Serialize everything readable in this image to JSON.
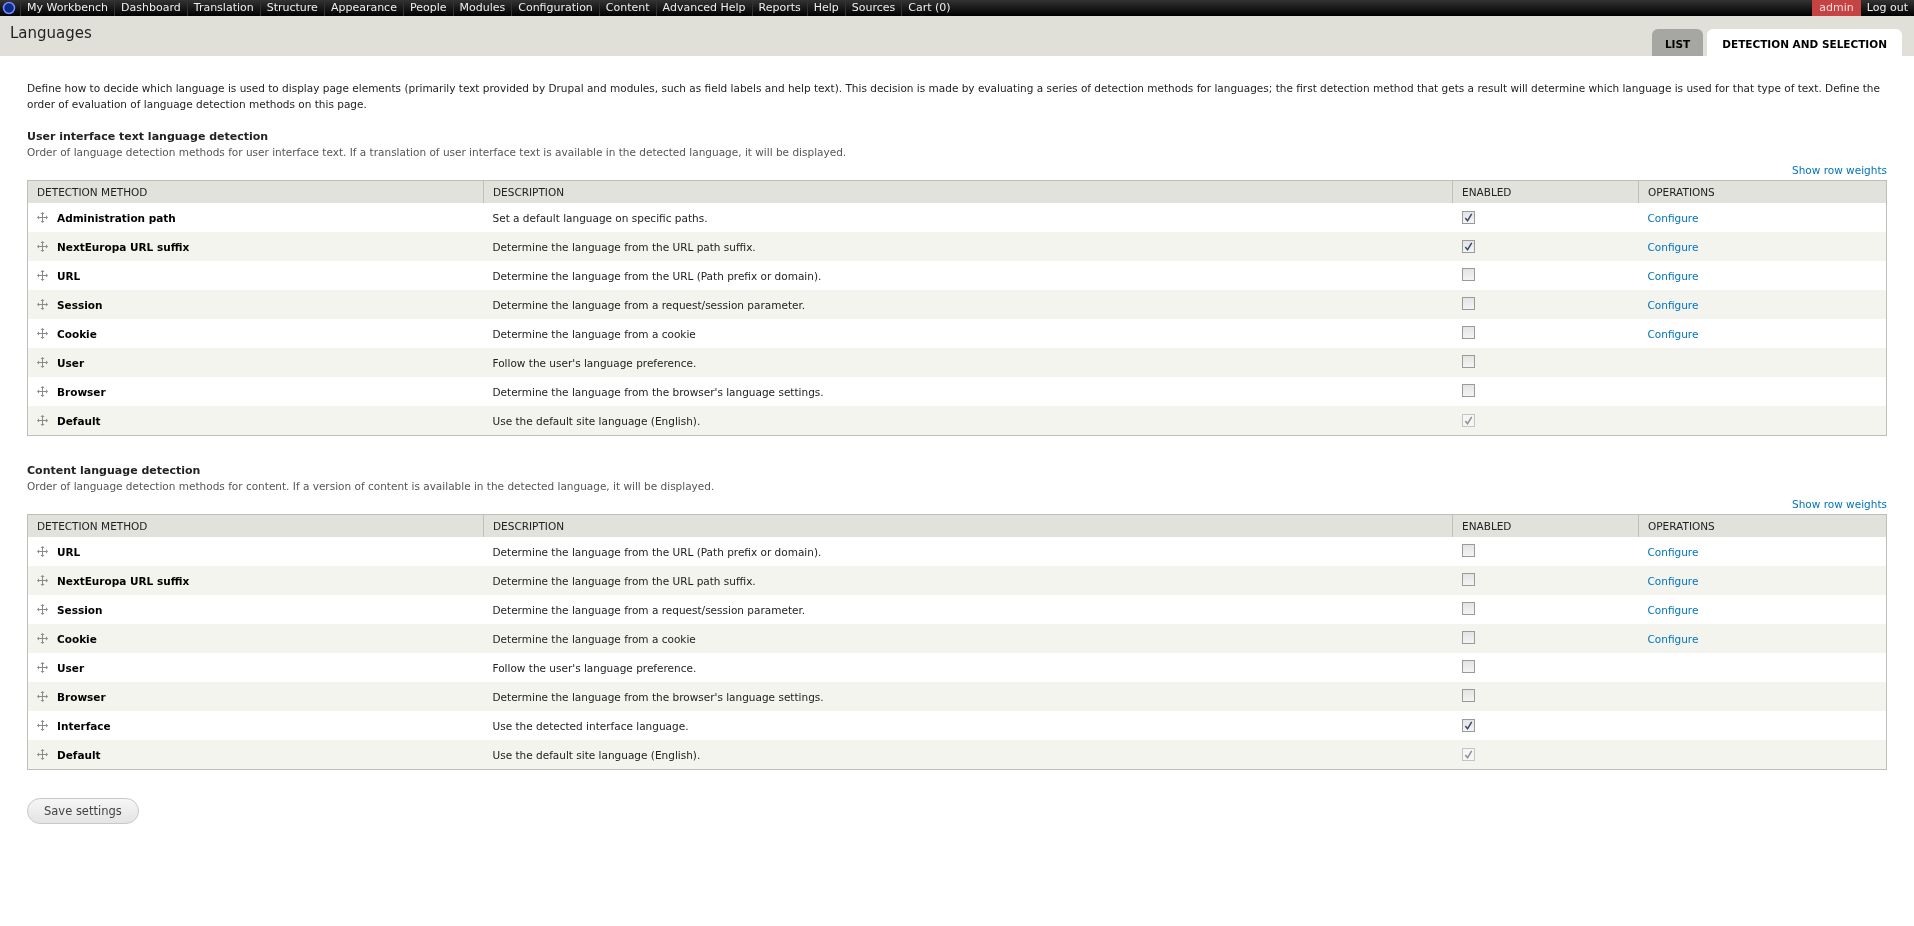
{
  "toolbar": {
    "menu": [
      {
        "label": "My Workbench"
      },
      {
        "label": "Dashboard"
      },
      {
        "label": "Translation"
      },
      {
        "label": "Structure"
      },
      {
        "label": "Appearance"
      },
      {
        "label": "People"
      },
      {
        "label": "Modules"
      },
      {
        "label": "Configuration"
      },
      {
        "label": "Content"
      },
      {
        "label": "Advanced Help"
      },
      {
        "label": "Reports"
      },
      {
        "label": "Help"
      },
      {
        "label": "Sources"
      },
      {
        "label": "Cart (0)"
      }
    ],
    "user": "admin",
    "logout": "Log out"
  },
  "header": {
    "title": "Languages",
    "tabs": [
      {
        "label": "LIST",
        "selected": false
      },
      {
        "label": "DETECTION AND SELECTION",
        "selected": true
      }
    ]
  },
  "intro": "Define how to decide which language is used to display page elements (primarily text provided by Drupal and modules, such as field labels and help text). This decision is made by evaluating a series of detection methods for languages; the first detection method that gets a result will determine which language is used for that type of text. Define the order of evaluation of language detection methods on this page.",
  "sections": [
    {
      "title": "User interface text language detection",
      "description": "Order of language detection methods for user interface text. If a translation of user interface text is available in the detected language, it will be displayed.",
      "weights_link": "Show row weights",
      "columns": [
        "DETECTION METHOD",
        "DESCRIPTION",
        "ENABLED",
        "OPERATIONS"
      ],
      "rows": [
        {
          "method": "Administration path",
          "description": "Set a default language on specific paths.",
          "checked": true,
          "disabled": false,
          "operation": "Configure"
        },
        {
          "method": "NextEuropa URL suffix",
          "description": "Determine the language from the URL path suffix.",
          "checked": true,
          "disabled": false,
          "operation": "Configure"
        },
        {
          "method": "URL",
          "description": "Determine the language from the URL (Path prefix or domain).",
          "checked": false,
          "disabled": false,
          "operation": "Configure"
        },
        {
          "method": "Session",
          "description": "Determine the language from a request/session parameter.",
          "checked": false,
          "disabled": false,
          "operation": "Configure"
        },
        {
          "method": "Cookie",
          "description": "Determine the language from a cookie",
          "checked": false,
          "disabled": false,
          "operation": "Configure"
        },
        {
          "method": "User",
          "description": "Follow the user's language preference.",
          "checked": false,
          "disabled": false
        },
        {
          "method": "Browser",
          "description": "Determine the language from the browser's language settings.",
          "checked": false,
          "disabled": false
        },
        {
          "method": "Default",
          "description": "Use the default site language (English).",
          "checked": true,
          "disabled": true
        }
      ]
    },
    {
      "title": "Content language detection",
      "description": "Order of language detection methods for content. If a version of content is available in the detected language, it will be displayed.",
      "weights_link": "Show row weights",
      "columns": [
        "DETECTION METHOD",
        "DESCRIPTION",
        "ENABLED",
        "OPERATIONS"
      ],
      "rows": [
        {
          "method": "URL",
          "description": "Determine the language from the URL (Path prefix or domain).",
          "checked": false,
          "disabled": false,
          "operation": "Configure"
        },
        {
          "method": "NextEuropa URL suffix",
          "description": "Determine the language from the URL path suffix.",
          "checked": false,
          "disabled": false,
          "operation": "Configure"
        },
        {
          "method": "Session",
          "description": "Determine the language from a request/session parameter.",
          "checked": false,
          "disabled": false,
          "operation": "Configure"
        },
        {
          "method": "Cookie",
          "description": "Determine the language from a cookie",
          "checked": false,
          "disabled": false,
          "operation": "Configure"
        },
        {
          "method": "User",
          "description": "Follow the user's language preference.",
          "checked": false,
          "disabled": false
        },
        {
          "method": "Browser",
          "description": "Determine the language from the browser's language settings.",
          "checked": false,
          "disabled": false
        },
        {
          "method": "Interface",
          "description": "Use the detected interface language.",
          "checked": true,
          "disabled": false
        },
        {
          "method": "Default",
          "description": "Use the default site language (English).",
          "checked": true,
          "disabled": true
        }
      ]
    }
  ],
  "save_button": "Save settings"
}
